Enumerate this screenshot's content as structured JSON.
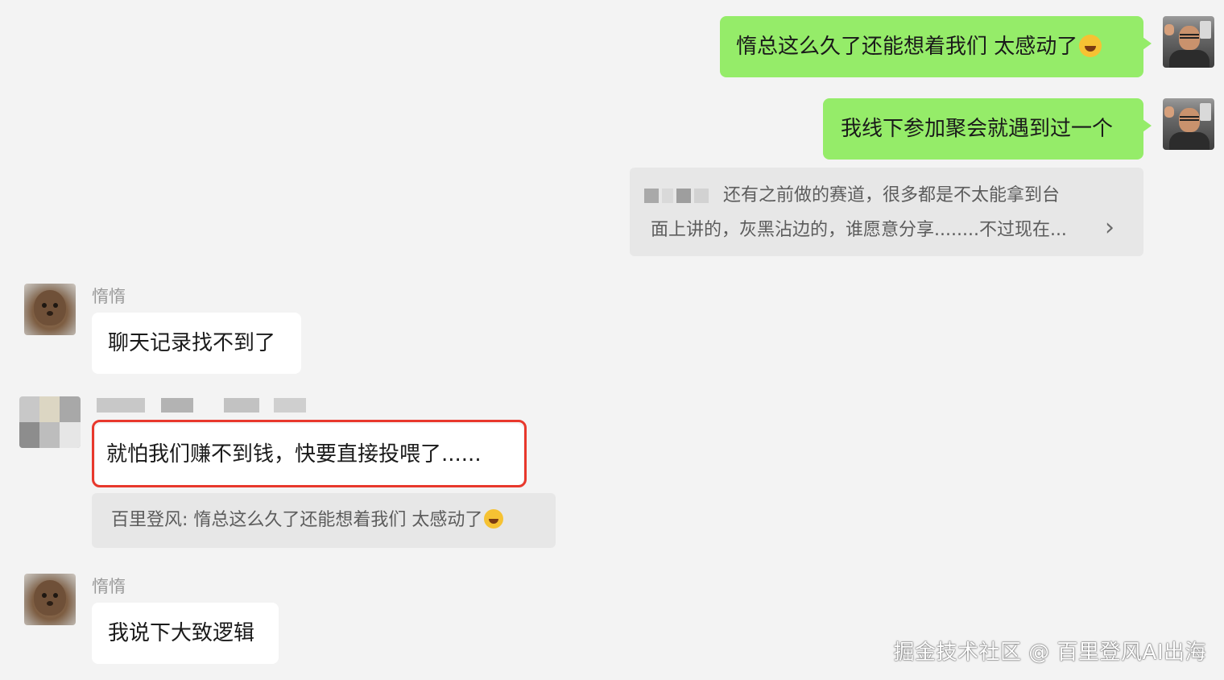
{
  "messages": {
    "m1": {
      "text": "惰总这么久了还能想着我们 太感动了",
      "emoji": "laughing-tears-emoji"
    },
    "m2": {
      "text": "我线下参加聚会就遇到过一个"
    },
    "m3": {
      "line1": "还有之前做的赛道，很多都是不太能拿到台",
      "line2": "面上讲的，灰黑沾边的，谁愿意分享........不过现在...",
      "arrow": "›"
    },
    "m4": {
      "sender": "惰惰",
      "text": "聊天记录找不到了"
    },
    "m5": {
      "text": "就怕我们赚不到钱，快要直接投喂了......",
      "quote": "百里登风: 惰总这么久了还能想着我们 太感动了"
    },
    "m6": {
      "sender": "惰惰",
      "text": "我说下大致逻辑"
    }
  },
  "colors": {
    "self_bubble": "#95ec69",
    "other_bubble": "#ffffff",
    "background": "#f3f3f3",
    "highlight_border": "#e8382c"
  },
  "watermark": "掘金技术社区 @ 百里登风AI出海"
}
